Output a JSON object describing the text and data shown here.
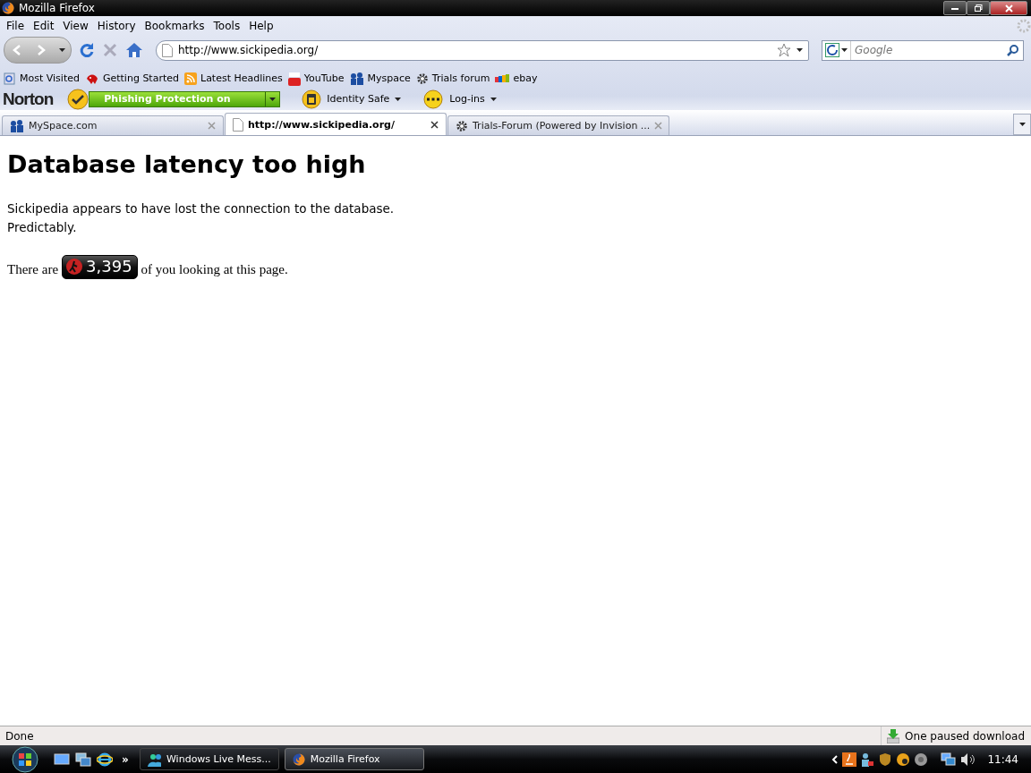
{
  "window": {
    "title": "Mozilla Firefox"
  },
  "menu": [
    "File",
    "Edit",
    "View",
    "History",
    "Bookmarks",
    "Tools",
    "Help"
  ],
  "navigation": {
    "url": "http://www.sickipedia.org/",
    "search_placeholder": "Google"
  },
  "bookmarks": [
    "Most Visited",
    "Getting Started",
    "Latest Headlines",
    "YouTube",
    "Myspace",
    "Trials forum",
    "ebay"
  ],
  "norton": {
    "brand": "Norton",
    "phishing": "Phishing Protection on",
    "identity": "Identity Safe",
    "logins": "Log-ins"
  },
  "tabs": [
    {
      "label": "MySpace.com",
      "selected": false
    },
    {
      "label": "http://www.sickipedia.org/",
      "selected": true
    },
    {
      "label": "Trials-Forum (Powered by Invision ...",
      "selected": false
    }
  ],
  "page": {
    "heading": "Database latency too high",
    "lines": [
      "Sickipedia appears to have lost the connection to the database.",
      "Predictably."
    ],
    "counter_before": "There are",
    "counter": "3,395",
    "counter_after": "of you looking at this page."
  },
  "status_bar": {
    "text": "Done",
    "download": "One paused download"
  },
  "taskbar": {
    "more": "»",
    "tasks": [
      {
        "label": "Windows Live Mess...",
        "selected": false
      },
      {
        "label": "Mozilla Firefox",
        "selected": true
      }
    ],
    "clock": "11:44"
  }
}
